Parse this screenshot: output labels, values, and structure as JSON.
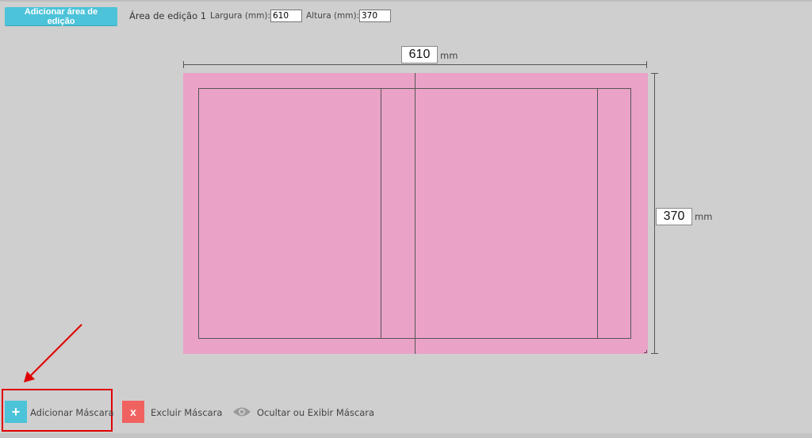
{
  "toolbar": {
    "add_area_label": "Adicionar área de edição",
    "area_name": "Área de edição 1",
    "width_label": "Largura (mm):",
    "width_value": "610",
    "height_label": "Altura (mm):",
    "height_value": "370"
  },
  "dimensions": {
    "width_value": "610",
    "height_value": "370",
    "unit": "mm"
  },
  "actions": {
    "add_mask_icon": "+",
    "add_mask_label": "Adicionar Máscara",
    "delete_mask_icon": "x",
    "delete_mask_label": "Excluir Máscara",
    "toggle_mask_label": "Ocultar ou Exibir Máscara"
  },
  "colors": {
    "accent": "#4cc3d9",
    "danger": "#f0625f",
    "canvas": "#eaa2c7",
    "highlight": "#e00000"
  }
}
